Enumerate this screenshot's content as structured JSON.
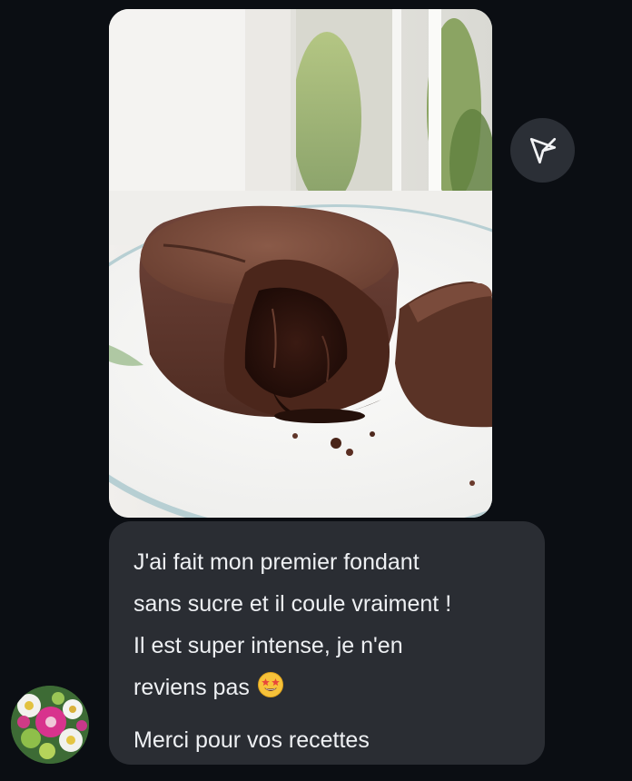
{
  "message": {
    "lines": [
      "J'ai fait mon premier fondant",
      "sans sucre et il coule vraiment !",
      "Il est super intense, je n'en",
      "reviens pas",
      "Merci pour vos recettes"
    ],
    "emoji": "star-struck-emoji"
  },
  "photo": {
    "subject": "chocolate-lava-cake"
  },
  "actions": {
    "share_icon": "paper-plane-icon"
  },
  "sender": {
    "avatar": "flower-avatar"
  },
  "colors": {
    "background": "#0b0e13",
    "bubble": "#2a2d33",
    "share_button": "#2b2f36",
    "text": "#eef0f3"
  }
}
